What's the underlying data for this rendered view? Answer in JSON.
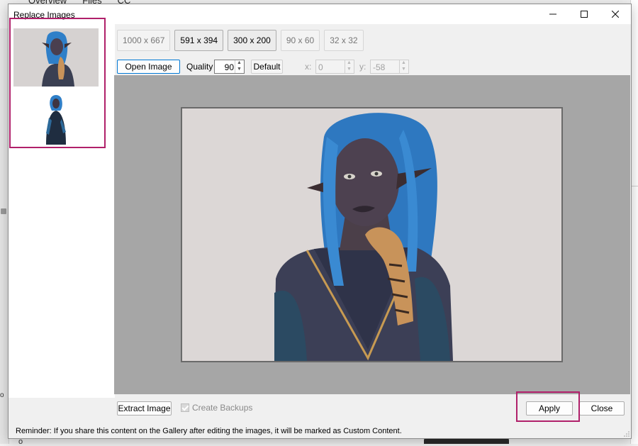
{
  "background_app": {
    "tabs": [
      "Overview",
      "Files",
      "CC"
    ],
    "left_text": "o",
    "bottom_text": "o"
  },
  "dialog": {
    "title": "Replace Images",
    "window_controls": [
      "minimize-icon",
      "maximize-icon",
      "close-icon"
    ]
  },
  "thumbnails": [
    {
      "label": "thumbnail-1",
      "selected": true
    },
    {
      "label": "thumbnail-2",
      "selected": false
    }
  ],
  "sizes": [
    {
      "label": "1000 x 667",
      "active": false
    },
    {
      "label": "591 x 394",
      "active": true
    },
    {
      "label": "300 x 200",
      "active": true
    },
    {
      "label": "90 x 60",
      "active": false
    },
    {
      "label": "32 x 32",
      "active": false
    }
  ],
  "controls": {
    "open_image": "Open Image",
    "quality_label": "Quality",
    "quality_value": "90",
    "default_label": "Default",
    "x_label": "x:",
    "x_value": "0",
    "y_label": "y:",
    "y_value": "-58"
  },
  "bottom": {
    "extract_image": "Extract Image",
    "create_backups": "Create Backups",
    "create_backups_checked": true,
    "apply": "Apply",
    "close": "Close",
    "reminder": "Reminder: If you share this content on the Gallery after editing the images, it will be marked as Custom Content."
  },
  "colors": {
    "highlight": "#b0206a",
    "accent": "#0078d4",
    "preview_bg": "#a6a6a6"
  }
}
